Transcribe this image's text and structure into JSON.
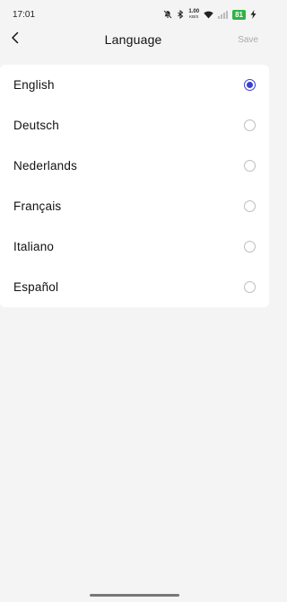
{
  "status_bar": {
    "time": "17:01",
    "net_speed_value": "1.00",
    "net_speed_unit": "KB/S",
    "battery": "81",
    "icons": [
      "mute-bell-icon",
      "bluetooth-icon",
      "wifi-icon",
      "signal-icon",
      "charging-icon"
    ]
  },
  "header": {
    "title": "Language",
    "save_label": "Save",
    "back_icon": "chevron-left-icon"
  },
  "languages": [
    {
      "label": "English",
      "selected": true
    },
    {
      "label": "Deutsch",
      "selected": false
    },
    {
      "label": "Nederlands",
      "selected": false
    },
    {
      "label": "Français",
      "selected": false
    },
    {
      "label": "Italiano",
      "selected": false
    },
    {
      "label": "Español",
      "selected": false
    }
  ],
  "colors": {
    "accent": "#3b3fd1",
    "background": "#f4f4f4",
    "battery": "#2fb344"
  }
}
